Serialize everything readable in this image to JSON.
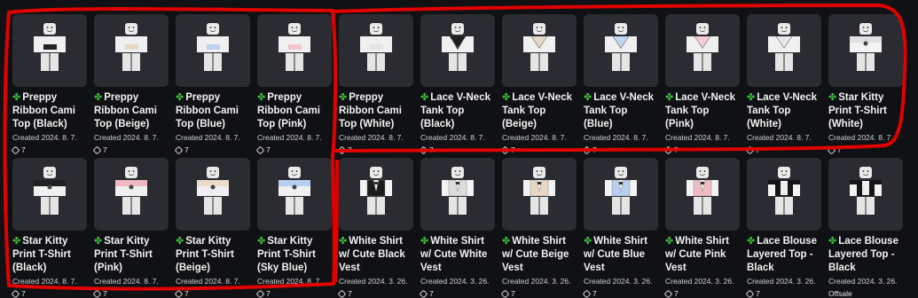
{
  "items": [
    {
      "name": "Preppy Ribbon Cami Top (Black)",
      "created": "Created 2024. 8. 7.",
      "price": "7",
      "shirt": "#f0f0f0",
      "accent": "#222222",
      "style": "cami"
    },
    {
      "name": "Preppy Ribbon Cami Top (Beige)",
      "created": "Created 2024. 8. 7.",
      "price": "7",
      "shirt": "#f0f0f0",
      "accent": "#e6d7c6",
      "style": "cami"
    },
    {
      "name": "Preppy Ribbon Cami Top (Blue)",
      "created": "Created 2024. 8. 7.",
      "price": "7",
      "shirt": "#f0f0f0",
      "accent": "#bcd2ee",
      "style": "cami"
    },
    {
      "name": "Preppy Ribbon Cami Top (Pink)",
      "created": "Created 2024. 8. 7.",
      "price": "7",
      "shirt": "#f0f0f0",
      "accent": "#f1c8cf",
      "style": "cami"
    },
    {
      "name": "Preppy Ribbon Cami Top (White)",
      "created": "Created 2024. 8. 7.",
      "price": "7",
      "shirt": "#f0f0f0",
      "accent": "#e8e3e3",
      "style": "cami"
    },
    {
      "name": "Lace V-Neck Tank Top (Black)",
      "created": "Created 2024. 8. 7.",
      "price": "7",
      "shirt": "#f0f0f0",
      "accent": "#1e1e1e",
      "style": "vneck"
    },
    {
      "name": "Lace V-Neck Tank Top (Beige)",
      "created": "Created 2024. 8. 7.",
      "price": "7",
      "shirt": "#f0f0f0",
      "accent": "#e4d8c8",
      "style": "vneck"
    },
    {
      "name": "Lace V-Neck Tank Top (Blue)",
      "created": "Created 2024. 8. 7.",
      "price": "7",
      "shirt": "#f0f0f0",
      "accent": "#c2d6f0",
      "style": "vneck"
    },
    {
      "name": "Lace V-Neck Tank Top (Pink)",
      "created": "Created 2024. 8. 7.",
      "price": "7",
      "shirt": "#f0f0f0",
      "accent": "#f2cdd3",
      "style": "vneck"
    },
    {
      "name": "Lace V-Neck Tank Top (White)",
      "created": "Created 2024. 8. 7.",
      "price": "7",
      "shirt": "#f0f0f0",
      "accent": "#e9e9e9",
      "style": "vneck"
    },
    {
      "name": "Star Kitty Print T-Shirt (White)",
      "created": "Created 2024. 8. 7.",
      "price": "7",
      "shirt": "#f3f3f3",
      "accent": "#e0e0e0",
      "style": "tee"
    },
    {
      "name": "Star Kitty Print T-Shirt (Black)",
      "created": "Created 2024. 8. 7.",
      "price": "7",
      "shirt": "#f0f0f0",
      "accent": "#1f1f1f",
      "style": "tee"
    },
    {
      "name": "Star Kitty Print T-Shirt (Pink)",
      "created": "Created 2024. 8. 7.",
      "price": "7",
      "shirt": "#f0f0f0",
      "accent": "#f0b8c0",
      "style": "tee"
    },
    {
      "name": "Star Kitty Print T-Shirt (Beige)",
      "created": "Created 2024. 8. 7.",
      "price": "7",
      "shirt": "#f0f0f0",
      "accent": "#eadccb",
      "style": "tee"
    },
    {
      "name": "Star Kitty Print T-Shirt (Sky Blue)",
      "created": "Created 2024. 8. 7.",
      "price": "7",
      "shirt": "#f0f0f0",
      "accent": "#b6cff0",
      "style": "tee"
    },
    {
      "name": "White Shirt w/ Cute Black Vest",
      "created": "Created 2024. 3. 26.",
      "price": "7",
      "shirt": "#f3f3f3",
      "accent": "#1c1c1c",
      "style": "vest"
    },
    {
      "name": "White Shirt w/ Cute White Vest",
      "created": "Created 2024. 3. 26.",
      "price": "7",
      "shirt": "#f3f3f3",
      "accent": "#dcdcdc",
      "style": "vest"
    },
    {
      "name": "White Shirt w/ Cute Beige Vest",
      "created": "Created 2024. 3. 26.",
      "price": "7",
      "shirt": "#f3f3f3",
      "accent": "#e6d8c4",
      "style": "vest"
    },
    {
      "name": "White Shirt w/ Cute Blue Vest",
      "created": "Created 2024. 3. 26.",
      "price": "7",
      "shirt": "#f3f3f3",
      "accent": "#b8cfee",
      "style": "vest"
    },
    {
      "name": "White Shirt w/ Cute Pink Vest",
      "created": "Created 2024. 3. 26.",
      "price": "7",
      "shirt": "#f3f3f3",
      "accent": "#f0bcc4",
      "style": "vest"
    },
    {
      "name": "Lace Blouse Layered Top - Black",
      "created": "Created 2024. 3. 26.",
      "price": "7",
      "shirt": "#f3f3f3",
      "accent": "#151515",
      "style": "blouse"
    },
    {
      "name": "Lace Blouse Layered Top - Black",
      "created": "Created 2024. 3. 26.",
      "price": "Offsale",
      "shirt": "#f3f3f3",
      "accent": "#151515",
      "style": "blouse"
    }
  ],
  "colors": {
    "highlight": "#e00000",
    "clover": "#3fbf3f",
    "background": "#101114",
    "card": "#2a2c31"
  },
  "icons": {
    "badge": "clover-icon",
    "currency": "robux-icon"
  }
}
